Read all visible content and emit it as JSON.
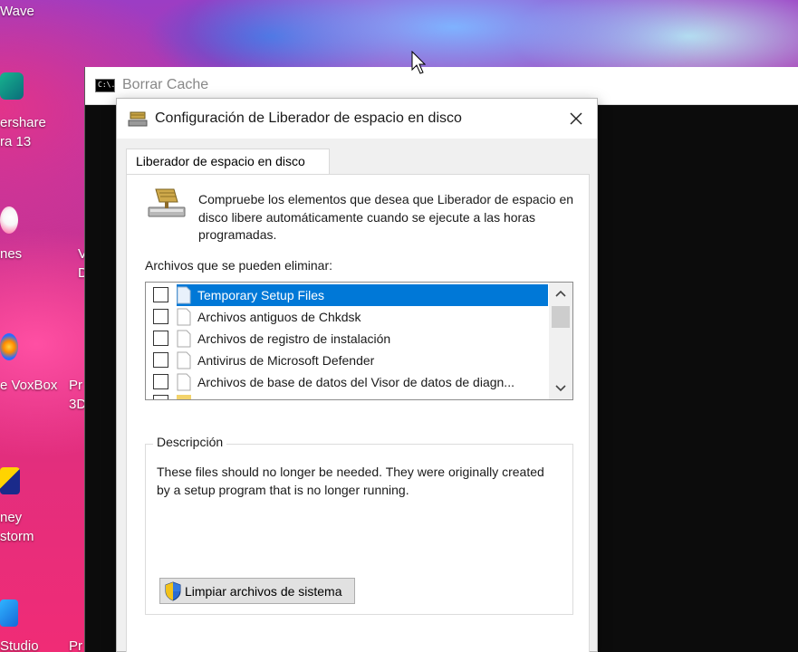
{
  "desktop": {
    "icons": [
      {
        "line1": "Wave",
        "line2": ""
      },
      {
        "line1": "ershare",
        "line2": "ra 13"
      },
      {
        "line1": "nes",
        "line2": ""
      },
      {
        "line1": "e VoxBox",
        "line2": ""
      },
      {
        "line1": "ney",
        "line2": "storm"
      },
      {
        "line1": "Studio",
        "line2": ""
      }
    ],
    "partial_labels": [
      "V",
      "D",
      "Pr",
      "3D",
      "Pr"
    ]
  },
  "console_window": {
    "icon_text": "C:\\.",
    "title": "Borrar Cache"
  },
  "dialog": {
    "title": "Configuración de Liberador de espacio en disco",
    "close_glyph": "✕",
    "tab_label": "Liberador de espacio en disco",
    "intro_text": "Compruebe los elementos que desea que Liberador de espacio en disco libere automáticamente cuando se ejecute a las horas programadas.",
    "files_label": "Archivos que se pueden eliminar:",
    "files": [
      {
        "label": "Temporary Setup Files",
        "checked": false,
        "selected": true
      },
      {
        "label": "Archivos antiguos de Chkdsk",
        "checked": false,
        "selected": false
      },
      {
        "label": "Archivos de registro de instalación",
        "checked": false,
        "selected": false
      },
      {
        "label": "Antivirus de Microsoft Defender",
        "checked": false,
        "selected": false
      },
      {
        "label": "Archivos de base de datos del Visor de datos de diagn...",
        "checked": false,
        "selected": false
      }
    ],
    "description_legend": "Descripción",
    "description_text": "These files should no longer be needed. They were originally created by a setup program that is no longer running.",
    "cleanup_button_label": "Limpiar archivos de sistema"
  },
  "colors": {
    "selection": "#0078d7",
    "dialog_bg": "#f0f0f0",
    "console_bg": "#0c0c0c"
  }
}
